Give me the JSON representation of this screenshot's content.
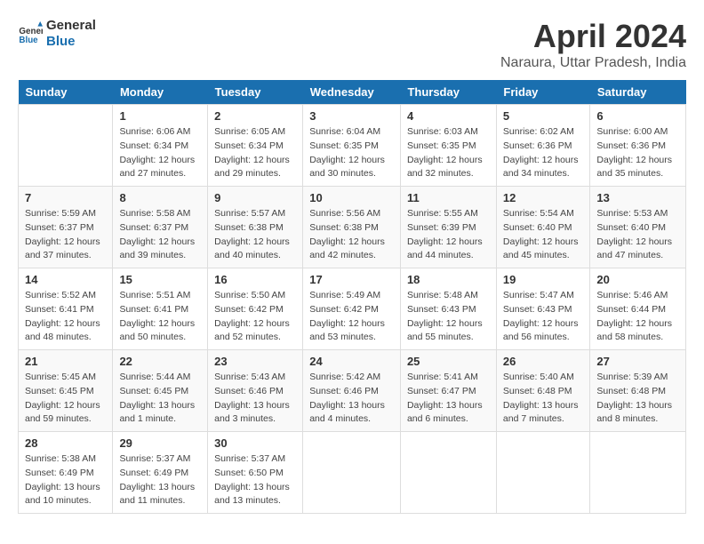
{
  "header": {
    "logo_line1": "General",
    "logo_line2": "Blue",
    "month": "April 2024",
    "location": "Naraura, Uttar Pradesh, India"
  },
  "weekdays": [
    "Sunday",
    "Monday",
    "Tuesday",
    "Wednesday",
    "Thursday",
    "Friday",
    "Saturday"
  ],
  "weeks": [
    [
      {
        "day": "",
        "sunrise": "",
        "sunset": "",
        "daylight": ""
      },
      {
        "day": "1",
        "sunrise": "6:06 AM",
        "sunset": "6:34 PM",
        "daylight": "12 hours and 27 minutes."
      },
      {
        "day": "2",
        "sunrise": "6:05 AM",
        "sunset": "6:34 PM",
        "daylight": "12 hours and 29 minutes."
      },
      {
        "day": "3",
        "sunrise": "6:04 AM",
        "sunset": "6:35 PM",
        "daylight": "12 hours and 30 minutes."
      },
      {
        "day": "4",
        "sunrise": "6:03 AM",
        "sunset": "6:35 PM",
        "daylight": "12 hours and 32 minutes."
      },
      {
        "day": "5",
        "sunrise": "6:02 AM",
        "sunset": "6:36 PM",
        "daylight": "12 hours and 34 minutes."
      },
      {
        "day": "6",
        "sunrise": "6:00 AM",
        "sunset": "6:36 PM",
        "daylight": "12 hours and 35 minutes."
      }
    ],
    [
      {
        "day": "7",
        "sunrise": "5:59 AM",
        "sunset": "6:37 PM",
        "daylight": "12 hours and 37 minutes."
      },
      {
        "day": "8",
        "sunrise": "5:58 AM",
        "sunset": "6:37 PM",
        "daylight": "12 hours and 39 minutes."
      },
      {
        "day": "9",
        "sunrise": "5:57 AM",
        "sunset": "6:38 PM",
        "daylight": "12 hours and 40 minutes."
      },
      {
        "day": "10",
        "sunrise": "5:56 AM",
        "sunset": "6:38 PM",
        "daylight": "12 hours and 42 minutes."
      },
      {
        "day": "11",
        "sunrise": "5:55 AM",
        "sunset": "6:39 PM",
        "daylight": "12 hours and 44 minutes."
      },
      {
        "day": "12",
        "sunrise": "5:54 AM",
        "sunset": "6:40 PM",
        "daylight": "12 hours and 45 minutes."
      },
      {
        "day": "13",
        "sunrise": "5:53 AM",
        "sunset": "6:40 PM",
        "daylight": "12 hours and 47 minutes."
      }
    ],
    [
      {
        "day": "14",
        "sunrise": "5:52 AM",
        "sunset": "6:41 PM",
        "daylight": "12 hours and 48 minutes."
      },
      {
        "day": "15",
        "sunrise": "5:51 AM",
        "sunset": "6:41 PM",
        "daylight": "12 hours and 50 minutes."
      },
      {
        "day": "16",
        "sunrise": "5:50 AM",
        "sunset": "6:42 PM",
        "daylight": "12 hours and 52 minutes."
      },
      {
        "day": "17",
        "sunrise": "5:49 AM",
        "sunset": "6:42 PM",
        "daylight": "12 hours and 53 minutes."
      },
      {
        "day": "18",
        "sunrise": "5:48 AM",
        "sunset": "6:43 PM",
        "daylight": "12 hours and 55 minutes."
      },
      {
        "day": "19",
        "sunrise": "5:47 AM",
        "sunset": "6:43 PM",
        "daylight": "12 hours and 56 minutes."
      },
      {
        "day": "20",
        "sunrise": "5:46 AM",
        "sunset": "6:44 PM",
        "daylight": "12 hours and 58 minutes."
      }
    ],
    [
      {
        "day": "21",
        "sunrise": "5:45 AM",
        "sunset": "6:45 PM",
        "daylight": "12 hours and 59 minutes."
      },
      {
        "day": "22",
        "sunrise": "5:44 AM",
        "sunset": "6:45 PM",
        "daylight": "13 hours and 1 minute."
      },
      {
        "day": "23",
        "sunrise": "5:43 AM",
        "sunset": "6:46 PM",
        "daylight": "13 hours and 3 minutes."
      },
      {
        "day": "24",
        "sunrise": "5:42 AM",
        "sunset": "6:46 PM",
        "daylight": "13 hours and 4 minutes."
      },
      {
        "day": "25",
        "sunrise": "5:41 AM",
        "sunset": "6:47 PM",
        "daylight": "13 hours and 6 minutes."
      },
      {
        "day": "26",
        "sunrise": "5:40 AM",
        "sunset": "6:48 PM",
        "daylight": "13 hours and 7 minutes."
      },
      {
        "day": "27",
        "sunrise": "5:39 AM",
        "sunset": "6:48 PM",
        "daylight": "13 hours and 8 minutes."
      }
    ],
    [
      {
        "day": "28",
        "sunrise": "5:38 AM",
        "sunset": "6:49 PM",
        "daylight": "13 hours and 10 minutes."
      },
      {
        "day": "29",
        "sunrise": "5:37 AM",
        "sunset": "6:49 PM",
        "daylight": "13 hours and 11 minutes."
      },
      {
        "day": "30",
        "sunrise": "5:37 AM",
        "sunset": "6:50 PM",
        "daylight": "13 hours and 13 minutes."
      },
      {
        "day": "",
        "sunrise": "",
        "sunset": "",
        "daylight": ""
      },
      {
        "day": "",
        "sunrise": "",
        "sunset": "",
        "daylight": ""
      },
      {
        "day": "",
        "sunrise": "",
        "sunset": "",
        "daylight": ""
      },
      {
        "day": "",
        "sunrise": "",
        "sunset": "",
        "daylight": ""
      }
    ]
  ]
}
